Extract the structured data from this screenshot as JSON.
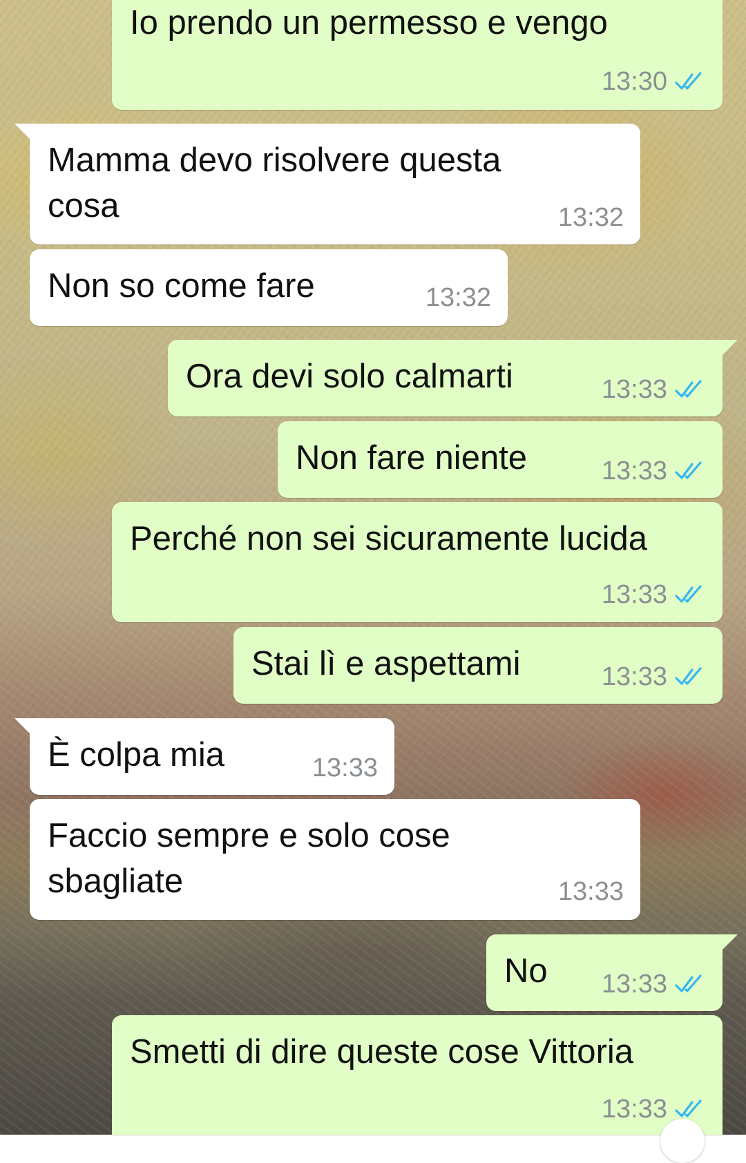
{
  "messages": [
    {
      "id": "m1",
      "direction": "out",
      "text_lines": [
        "Io prendo un permesso e vengo"
      ],
      "time": "13:30",
      "read": true
    },
    {
      "id": "m2",
      "direction": "in",
      "text_lines": [
        "Mamma devo risolvere questa",
        "cosa"
      ],
      "time": "13:32"
    },
    {
      "id": "m3",
      "direction": "in",
      "text_lines": [
        "Non so come fare"
      ],
      "time": "13:32"
    },
    {
      "id": "m4",
      "direction": "out",
      "text_lines": [
        "Ora devi solo calmarti"
      ],
      "time": "13:33",
      "read": true
    },
    {
      "id": "m5",
      "direction": "out",
      "text_lines": [
        "Non fare niente"
      ],
      "time": "13:33",
      "read": true
    },
    {
      "id": "m6",
      "direction": "out",
      "text_lines": [
        "Perché non sei sicuramente lucida"
      ],
      "time": "13:33",
      "read": true
    },
    {
      "id": "m7",
      "direction": "out",
      "text_lines": [
        "Stai lì e aspettami"
      ],
      "time": "13:33",
      "read": true
    },
    {
      "id": "m8",
      "direction": "in",
      "text_lines": [
        "È colpa mia"
      ],
      "time": "13:33"
    },
    {
      "id": "m9",
      "direction": "in",
      "text_lines": [
        "Faccio sempre e solo cose",
        "sbagliate"
      ],
      "time": "13:33"
    },
    {
      "id": "m10",
      "direction": "out",
      "text_lines": [
        "No"
      ],
      "time": "13:33",
      "read": true
    },
    {
      "id": "m11",
      "direction": "out",
      "text_lines": [
        "Smetti di dire queste cose Vittoria"
      ],
      "time": "13:33",
      "read": true
    }
  ],
  "colors": {
    "outgoing_bubble": "#e1fec6",
    "incoming_bubble": "#ffffff",
    "time_text": "#8a8f93",
    "read_ticks": "#34b7f1"
  },
  "icons": {
    "read_receipt": "double-check-icon",
    "scroll_button": "scroll-down-button"
  }
}
